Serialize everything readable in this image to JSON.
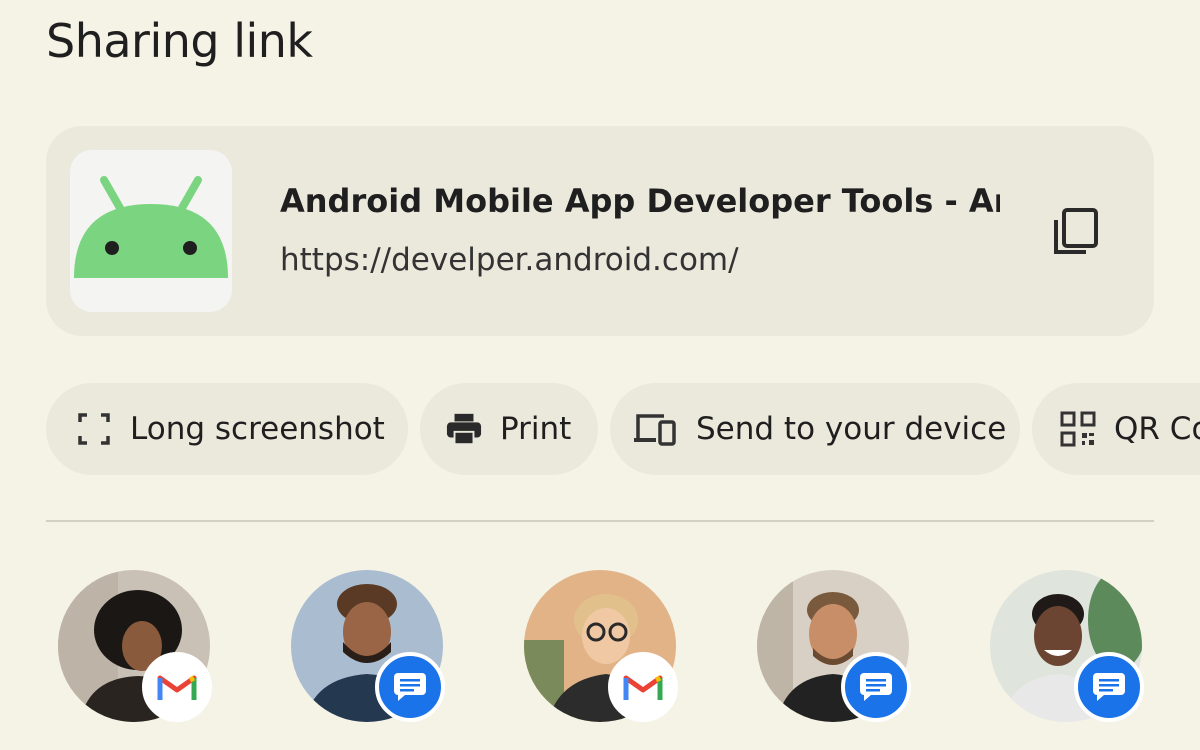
{
  "header": {
    "title": "Sharing link"
  },
  "link": {
    "app_icon": "android-robot-icon",
    "title": "Android Mobile App Developer Tools - An...",
    "url": "https://develper.android.com/",
    "copy_icon": "copy-icon"
  },
  "actions": [
    {
      "label": "Long screenshot",
      "icon": "long-screenshot-icon"
    },
    {
      "label": "Print",
      "icon": "printer-icon"
    },
    {
      "label": "Send to your device",
      "icon": "devices-icon"
    },
    {
      "label": "QR Co",
      "icon": "qr-code-icon"
    }
  ],
  "contacts": [
    {
      "avatar": "person-photo",
      "app": "gmail-icon"
    },
    {
      "avatar": "person-photo",
      "app": "messages-icon"
    },
    {
      "avatar": "person-photo",
      "app": "gmail-icon"
    },
    {
      "avatar": "person-photo",
      "app": "messages-icon"
    },
    {
      "avatar": "person-photo",
      "app": "messages-icon"
    }
  ],
  "colors": {
    "background": "#f5f2e6",
    "card": "#ebe8dc",
    "android_green": "#7bd47f",
    "messages_blue": "#1a73e8",
    "gmail_red": "#ea4335"
  }
}
